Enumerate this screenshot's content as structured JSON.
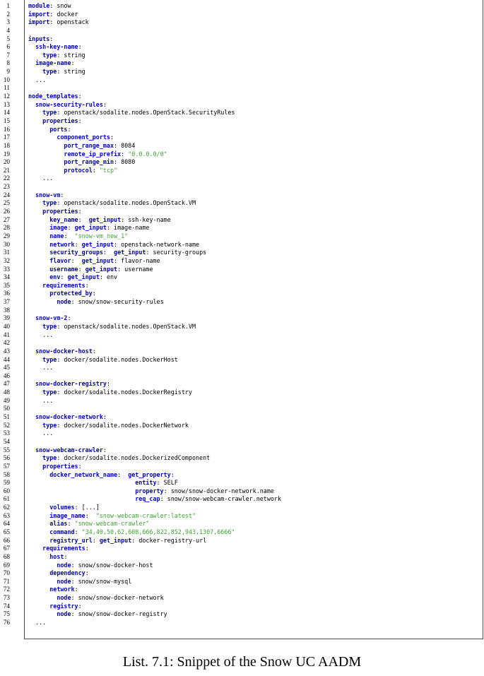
{
  "listing": {
    "lines": [
      [
        {
          "t": "module",
          "c": "k"
        },
        {
          "t": ": snow"
        }
      ],
      [
        {
          "t": "import",
          "c": "k"
        },
        {
          "t": ": docker"
        }
      ],
      [
        {
          "t": "import",
          "c": "k"
        },
        {
          "t": ": openstack"
        }
      ],
      [],
      [
        {
          "t": "inputs",
          "c": "k"
        },
        {
          "t": ":"
        }
      ],
      [
        {
          "t": "  "
        },
        {
          "t": "ssh-key-name",
          "c": "k"
        },
        {
          "t": ":"
        }
      ],
      [
        {
          "t": "    "
        },
        {
          "t": "type",
          "c": "k"
        },
        {
          "t": ": string"
        }
      ],
      [
        {
          "t": "  "
        },
        {
          "t": "image-name",
          "c": "k"
        },
        {
          "t": ":"
        }
      ],
      [
        {
          "t": "    "
        },
        {
          "t": "type",
          "c": "k"
        },
        {
          "t": ": string"
        }
      ],
      [
        {
          "t": "  ..."
        }
      ],
      [],
      [
        {
          "t": "node_templates",
          "c": "k"
        },
        {
          "t": ":"
        }
      ],
      [
        {
          "t": "  "
        },
        {
          "t": "snow-security-rules",
          "c": "k"
        },
        {
          "t": ":"
        }
      ],
      [
        {
          "t": "    "
        },
        {
          "t": "type",
          "c": "k"
        },
        {
          "t": ": openstack/sodalite.nodes.OpenStack.SecurityRules"
        }
      ],
      [
        {
          "t": "    "
        },
        {
          "t": "properties",
          "c": "k"
        },
        {
          "t": ":"
        }
      ],
      [
        {
          "t": "      "
        },
        {
          "t": "ports",
          "c": "k"
        },
        {
          "t": ":"
        }
      ],
      [
        {
          "t": "        "
        },
        {
          "t": "component_ports",
          "c": "k"
        },
        {
          "t": ":"
        }
      ],
      [
        {
          "t": "          "
        },
        {
          "t": "port_range_max",
          "c": "k"
        },
        {
          "t": ": 8084"
        }
      ],
      [
        {
          "t": "          "
        },
        {
          "t": "remote_ip_prefix",
          "c": "k"
        },
        {
          "t": ": "
        },
        {
          "t": "\"0.0.0.0/0\"",
          "c": "s"
        }
      ],
      [
        {
          "t": "          "
        },
        {
          "t": "port_range_min",
          "c": "k"
        },
        {
          "t": ": 8080"
        }
      ],
      [
        {
          "t": "          "
        },
        {
          "t": "protocol",
          "c": "k"
        },
        {
          "t": ": "
        },
        {
          "t": "\"tcp\"",
          "c": "s"
        }
      ],
      [
        {
          "t": "    ..."
        }
      ],
      [],
      [
        {
          "t": "  "
        },
        {
          "t": "snow-vm",
          "c": "k"
        },
        {
          "t": ":"
        }
      ],
      [
        {
          "t": "    "
        },
        {
          "t": "type",
          "c": "k"
        },
        {
          "t": ": openstack/sodalite.nodes.OpenStack.VM"
        }
      ],
      [
        {
          "t": "    "
        },
        {
          "t": "properties",
          "c": "k"
        },
        {
          "t": ":"
        }
      ],
      [
        {
          "t": "      "
        },
        {
          "t": "key_name",
          "c": "k"
        },
        {
          "t": ":  "
        },
        {
          "t": "get_input",
          "c": "k"
        },
        {
          "t": ": ssh-key-name"
        }
      ],
      [
        {
          "t": "      "
        },
        {
          "t": "image",
          "c": "k"
        },
        {
          "t": ": "
        },
        {
          "t": "get_input",
          "c": "k"
        },
        {
          "t": ": image-name"
        }
      ],
      [
        {
          "t": "      "
        },
        {
          "t": "name",
          "c": "k"
        },
        {
          "t": ":  "
        },
        {
          "t": "\"snow-vm_new_1\"",
          "c": "s"
        }
      ],
      [
        {
          "t": "      "
        },
        {
          "t": "network",
          "c": "k"
        },
        {
          "t": ": "
        },
        {
          "t": "get_input",
          "c": "k"
        },
        {
          "t": ": openstack-network-name"
        }
      ],
      [
        {
          "t": "      "
        },
        {
          "t": "security_groups",
          "c": "k"
        },
        {
          "t": ":  "
        },
        {
          "t": "get_input",
          "c": "k"
        },
        {
          "t": ": security-groups"
        }
      ],
      [
        {
          "t": "      "
        },
        {
          "t": "flavor",
          "c": "k"
        },
        {
          "t": ":  "
        },
        {
          "t": "get_input",
          "c": "k"
        },
        {
          "t": ": flavor-name"
        }
      ],
      [
        {
          "t": "      "
        },
        {
          "t": "username",
          "c": "k"
        },
        {
          "t": ": "
        },
        {
          "t": "get_input",
          "c": "k"
        },
        {
          "t": ": username"
        }
      ],
      [
        {
          "t": "      "
        },
        {
          "t": "env",
          "c": "k"
        },
        {
          "t": ": "
        },
        {
          "t": "get_input",
          "c": "k"
        },
        {
          "t": ": env"
        }
      ],
      [
        {
          "t": "    "
        },
        {
          "t": "requirements",
          "c": "k"
        },
        {
          "t": ":"
        }
      ],
      [
        {
          "t": "      "
        },
        {
          "t": "protected_by",
          "c": "k"
        },
        {
          "t": ":"
        }
      ],
      [
        {
          "t": "        "
        },
        {
          "t": "node",
          "c": "k"
        },
        {
          "t": ": snow/snow-security-rules"
        }
      ],
      [],
      [
        {
          "t": "  "
        },
        {
          "t": "snow-vm-2",
          "c": "k"
        },
        {
          "t": ":"
        }
      ],
      [
        {
          "t": "    "
        },
        {
          "t": "type",
          "c": "k"
        },
        {
          "t": ": openstack/sodalite.nodes.OpenStack.VM"
        }
      ],
      [
        {
          "t": "    ..."
        }
      ],
      [],
      [
        {
          "t": "  "
        },
        {
          "t": "snow-docker-host",
          "c": "k"
        },
        {
          "t": ":"
        }
      ],
      [
        {
          "t": "    "
        },
        {
          "t": "type",
          "c": "k"
        },
        {
          "t": ": docker/sodalite.nodes.DockerHost"
        }
      ],
      [
        {
          "t": "    ..."
        }
      ],
      [],
      [
        {
          "t": "  "
        },
        {
          "t": "snow-docker-registry",
          "c": "k"
        },
        {
          "t": ":"
        }
      ],
      [
        {
          "t": "    "
        },
        {
          "t": "type",
          "c": "k"
        },
        {
          "t": ": docker/sodalite.nodes.DockerRegistry"
        }
      ],
      [
        {
          "t": "    ..."
        }
      ],
      [],
      [
        {
          "t": "  "
        },
        {
          "t": "snow-docker-network",
          "c": "k"
        },
        {
          "t": ":"
        }
      ],
      [
        {
          "t": "    "
        },
        {
          "t": "type",
          "c": "k"
        },
        {
          "t": ": docker/sodalite.nodes.DockerNetwork"
        }
      ],
      [
        {
          "t": "    ..."
        }
      ],
      [],
      [
        {
          "t": "  "
        },
        {
          "t": "snow-webcam-crawler",
          "c": "k"
        },
        {
          "t": ":"
        }
      ],
      [
        {
          "t": "    "
        },
        {
          "t": "type",
          "c": "k"
        },
        {
          "t": ": docker/sodalite.nodes.DockerizedComponent"
        }
      ],
      [
        {
          "t": "    "
        },
        {
          "t": "properties",
          "c": "k"
        },
        {
          "t": ":"
        }
      ],
      [
        {
          "t": "      "
        },
        {
          "t": "docker_network_name",
          "c": "k"
        },
        {
          "t": ":  "
        },
        {
          "t": "get_property",
          "c": "k"
        },
        {
          "t": ":"
        }
      ],
      [
        {
          "t": "                              "
        },
        {
          "t": "entity",
          "c": "k"
        },
        {
          "t": ": SELF"
        }
      ],
      [
        {
          "t": "                              "
        },
        {
          "t": "property",
          "c": "k"
        },
        {
          "t": ": snow/snow-docker-network.name"
        }
      ],
      [
        {
          "t": "                              "
        },
        {
          "t": "req_cap",
          "c": "k"
        },
        {
          "t": ": snow/snow-webcam-crawler.network"
        }
      ],
      [
        {
          "t": "      "
        },
        {
          "t": "volumes",
          "c": "k"
        },
        {
          "t": ": [...]"
        }
      ],
      [
        {
          "t": "      "
        },
        {
          "t": "image_name",
          "c": "k"
        },
        {
          "t": ":  "
        },
        {
          "t": "\"snow-webcam-crawler:latest\"",
          "c": "s"
        }
      ],
      [
        {
          "t": "      "
        },
        {
          "t": "alias",
          "c": "k"
        },
        {
          "t": ": "
        },
        {
          "t": "\"snow-webcam-crawler\"",
          "c": "s"
        }
      ],
      [
        {
          "t": "      "
        },
        {
          "t": "command",
          "c": "k"
        },
        {
          "t": ": "
        },
        {
          "t": "\"34,40,50,62,608,666,822,852,943,1307,6666\"",
          "c": "s"
        }
      ],
      [
        {
          "t": "      "
        },
        {
          "t": "registry_url",
          "c": "k"
        },
        {
          "t": ": "
        },
        {
          "t": "get_input",
          "c": "k"
        },
        {
          "t": ": docker-registry-url"
        }
      ],
      [
        {
          "t": "    "
        },
        {
          "t": "requirements",
          "c": "k"
        },
        {
          "t": ":"
        }
      ],
      [
        {
          "t": "      "
        },
        {
          "t": "host",
          "c": "k"
        },
        {
          "t": ":"
        }
      ],
      [
        {
          "t": "        "
        },
        {
          "t": "node",
          "c": "k"
        },
        {
          "t": ": snow/snow-docker-host"
        }
      ],
      [
        {
          "t": "      "
        },
        {
          "t": "dependency",
          "c": "k"
        },
        {
          "t": ":"
        }
      ],
      [
        {
          "t": "        "
        },
        {
          "t": "node",
          "c": "k"
        },
        {
          "t": ": snow/snow-mysql"
        }
      ],
      [
        {
          "t": "      "
        },
        {
          "t": "network",
          "c": "k"
        },
        {
          "t": ":"
        }
      ],
      [
        {
          "t": "        "
        },
        {
          "t": "node",
          "c": "k"
        },
        {
          "t": ": snow/snow-docker-network"
        }
      ],
      [
        {
          "t": "      "
        },
        {
          "t": "registry",
          "c": "k"
        },
        {
          "t": ":"
        }
      ],
      [
        {
          "t": "        "
        },
        {
          "t": "node",
          "c": "k"
        },
        {
          "t": ": snow/snow-docker-registry"
        }
      ],
      [
        {
          "t": "  ..."
        }
      ]
    ]
  },
  "caption": "List. 7.1: Snippet of the Snow UC AADM"
}
